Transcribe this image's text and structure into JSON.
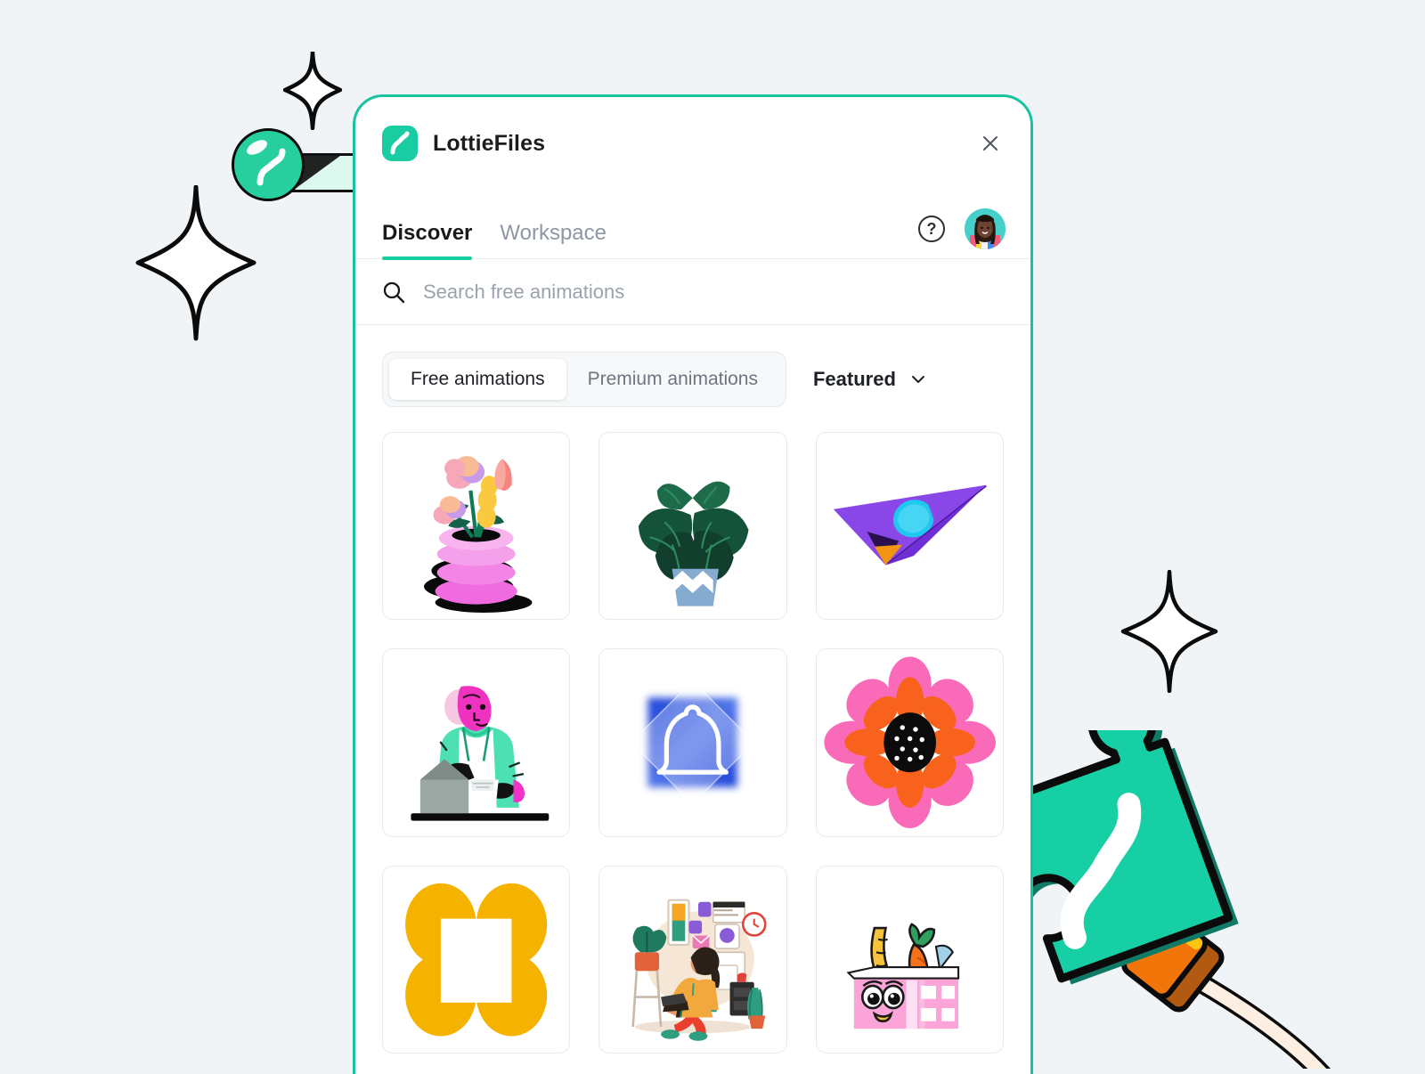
{
  "theme": {
    "page_background": "#F0F4F7",
    "brand_teal": "#19CCA2",
    "window_border": "#19C3A0",
    "text_dark": "#1D2026",
    "text_muted": "#8D98A4"
  },
  "decorations": {
    "sparkle_small": "sparkle-icon",
    "sparkle_large": "sparkle-icon",
    "sparkle_bottom_right": "sparkle-icon",
    "logo_ball": "lottiefiles-wave-logo-ball",
    "logo_bar": "connector-bar",
    "puzzle_piece": "lottiefiles-puzzle-piece",
    "plug": "orange-plug-connector",
    "cable": "cream-cable"
  },
  "window": {
    "titlebar": {
      "app_icon": "lottiefiles-logo-icon",
      "app_name": "LottieFiles",
      "close_icon": "close-icon"
    },
    "tabs": [
      {
        "label": "Discover",
        "active": true
      },
      {
        "label": "Workspace",
        "active": false
      }
    ],
    "tab_actions": {
      "help_icon": "question-mark-icon",
      "help_label": "?",
      "avatar": "user-avatar"
    },
    "search": {
      "icon": "search-icon",
      "placeholder": "Search free animations",
      "value": ""
    },
    "filters": {
      "segments": [
        {
          "label": "Free animations",
          "active": true
        },
        {
          "label": "Premium animations",
          "active": false
        }
      ],
      "sort": {
        "label": "Featured",
        "chevron_icon": "chevron-down-icon"
      }
    },
    "grid": {
      "items": [
        {
          "name": "flower-pot-animation",
          "alt": "Pink spiral pot with pastel flowers"
        },
        {
          "name": "potted-plant-animation",
          "alt": "Green leafy plant in blue zigzag pot"
        },
        {
          "name": "paper-plane-animation",
          "alt": "Purple paper plane with blue circle"
        },
        {
          "name": "unboxing-person-animation",
          "alt": "Person in green apron unboxing a parcel"
        },
        {
          "name": "notification-bell-animation",
          "alt": "White bell on blue gradient square"
        },
        {
          "name": "pink-orange-flower-animation",
          "alt": "Pink and orange flower with dotted centre"
        },
        {
          "name": "yellow-clover-animation",
          "alt": "Yellow four-petal clover shape"
        },
        {
          "name": "work-from-home-animation",
          "alt": "Woman working on laptop at home desk"
        },
        {
          "name": "grocery-box-animation",
          "alt": "Pink grocery box with face, bread and carrot"
        }
      ]
    }
  }
}
